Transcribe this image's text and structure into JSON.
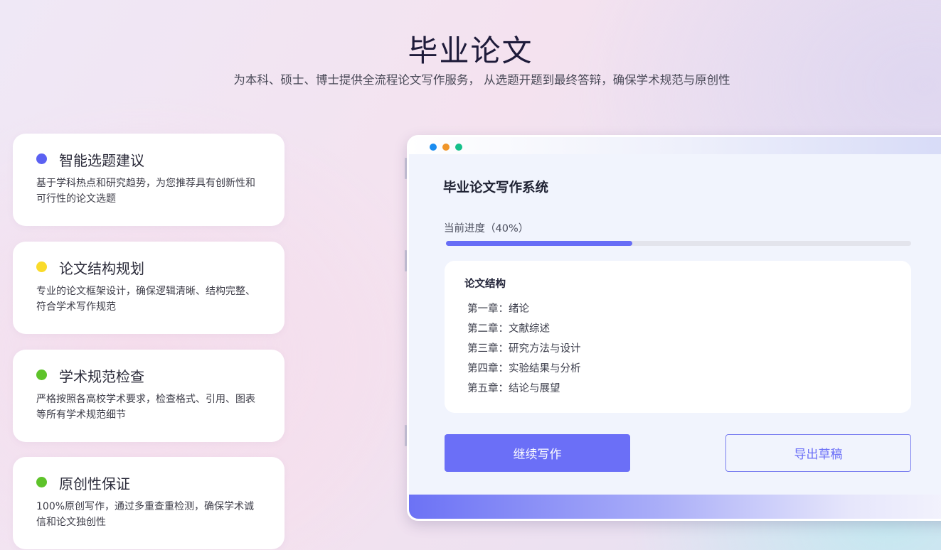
{
  "header": {
    "title": "毕业论文",
    "subtitle": "为本科、硕士、博士提供全流程论文写作服务， 从选题开题到最终答辩，确保学术规范与原创性"
  },
  "features": [
    {
      "title": "智能选题建议",
      "desc": "基于学科热点和研究趋势，为您推荐具有创新性和可行性的论文选题",
      "color": "#5b61f2"
    },
    {
      "title": "论文结构规划",
      "desc": "专业的论文框架设计，确保逻辑清晰、结构完整、符合学术写作规范",
      "color": "#fadb2a"
    },
    {
      "title": "学术规范检查",
      "desc": "严格按照各高校学术要求，检查格式、引用、图表等所有学术规范细节",
      "color": "#5ec32a"
    },
    {
      "title": "原创性保证",
      "desc": "100%原创写作，通过多重查重检测，确保学术诚信和论文独创性",
      "color": "#5ec32a"
    }
  ],
  "window": {
    "dots": [
      "#1a8cf0",
      "#f0962a",
      "#16c08a"
    ],
    "title": "毕业论文写作系统",
    "progress_label": "当前进度（40%）",
    "progress": 0.4,
    "structure": {
      "title": "论文结构",
      "chapters": [
        "第一章：绪论",
        "第二章：文献综述",
        "第三章：研究方法与设计",
        "第四章：实验结果与分析",
        "第五章：结论与展望"
      ]
    },
    "continue_label": "继续写作",
    "export_label": "导出草稿"
  }
}
